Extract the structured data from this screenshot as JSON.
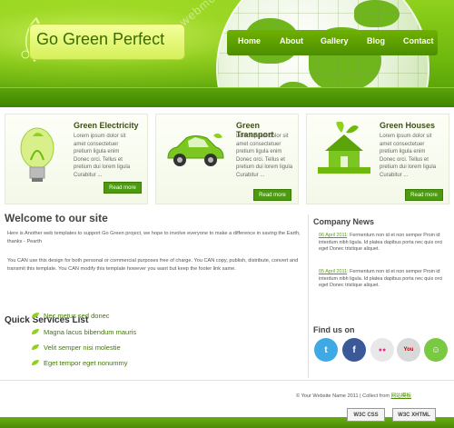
{
  "logo": {
    "text": "Go Green Perfect"
  },
  "nav": [
    "Home",
    "About",
    "Gallery",
    "Blog",
    "Contact"
  ],
  "watermark": "webmoban.net",
  "features": [
    {
      "title": "Green Electricity",
      "text": "Lorem ipsum dolor sit amet consectetuer pretium ligula enim Donec orci. Tellus et pretium dui lorem ligula Curabitur ...",
      "button": "Read more"
    },
    {
      "title": "Green Transport",
      "text": "Lorem ipsum dolor sit amet consectetuer pretium ligula enim Donec orci. Tellus et pretium dui lorem ligula Curabitur ...",
      "button": "Read more"
    },
    {
      "title": "Green Houses",
      "text": "Lorem ipsum dolor sit amet consectetuer pretium ligula enim Donec orci. Tellus et pretium dui lorem ligula Curabitur ...",
      "button": "Read more"
    }
  ],
  "welcome": {
    "title": "Welcome to our site",
    "para1": "Here is Another web templates to support Go Green project, we hope to involve everyone to make a difference in saving the Earth, thanks - Pearth",
    "para2": "You CAN use this design for both personal or commercial purposes free of charge. You CAN copy, publish, distribute, convert and transmit this template. You CAN modify this template however you want but keep the footer link same."
  },
  "quick_services": {
    "title": "Quick Services List",
    "items": [
      "Nec metus sed donec",
      "Magna lacus bibendum mauris",
      "Velit semper nisi molestie",
      "Eget tempor eget nonummy"
    ]
  },
  "news": {
    "title": "Company News",
    "items": [
      {
        "date": "06 April 2011",
        "text": ": Fermentum non id et non semper Proin id interdum nibh ligula. Id platea dapibus porta nec quis orci eget Donec tristique aliquet."
      },
      {
        "date": "05 April 2011",
        "text": ": Fermentum non id et non semper Proin id interdum nibh ligula. Id platea dapibus porta nec quis orci eget Donec tristique aliquet."
      }
    ]
  },
  "social": {
    "title": "Find us on",
    "icons": [
      {
        "name": "twitter",
        "color": "#3fa9e6",
        "glyph": "t"
      },
      {
        "name": "facebook",
        "color": "#3b5998",
        "glyph": "f"
      },
      {
        "name": "flickr",
        "color": "#e8e8e8",
        "glyph": "●●"
      },
      {
        "name": "youtube",
        "color": "#d9d9d9",
        "glyph": "You"
      },
      {
        "name": "chat",
        "color": "#7ac943",
        "glyph": "☺"
      }
    ]
  },
  "footer": {
    "copyright": "© Your Website Name 2011 | Collect from ",
    "link": "网站模板",
    "badge_css": "W3C CSS",
    "badge_xhtml": "W3C XHTML"
  },
  "colors": {
    "brand_green": "#6fb80d",
    "dark_green": "#4b9a10"
  }
}
